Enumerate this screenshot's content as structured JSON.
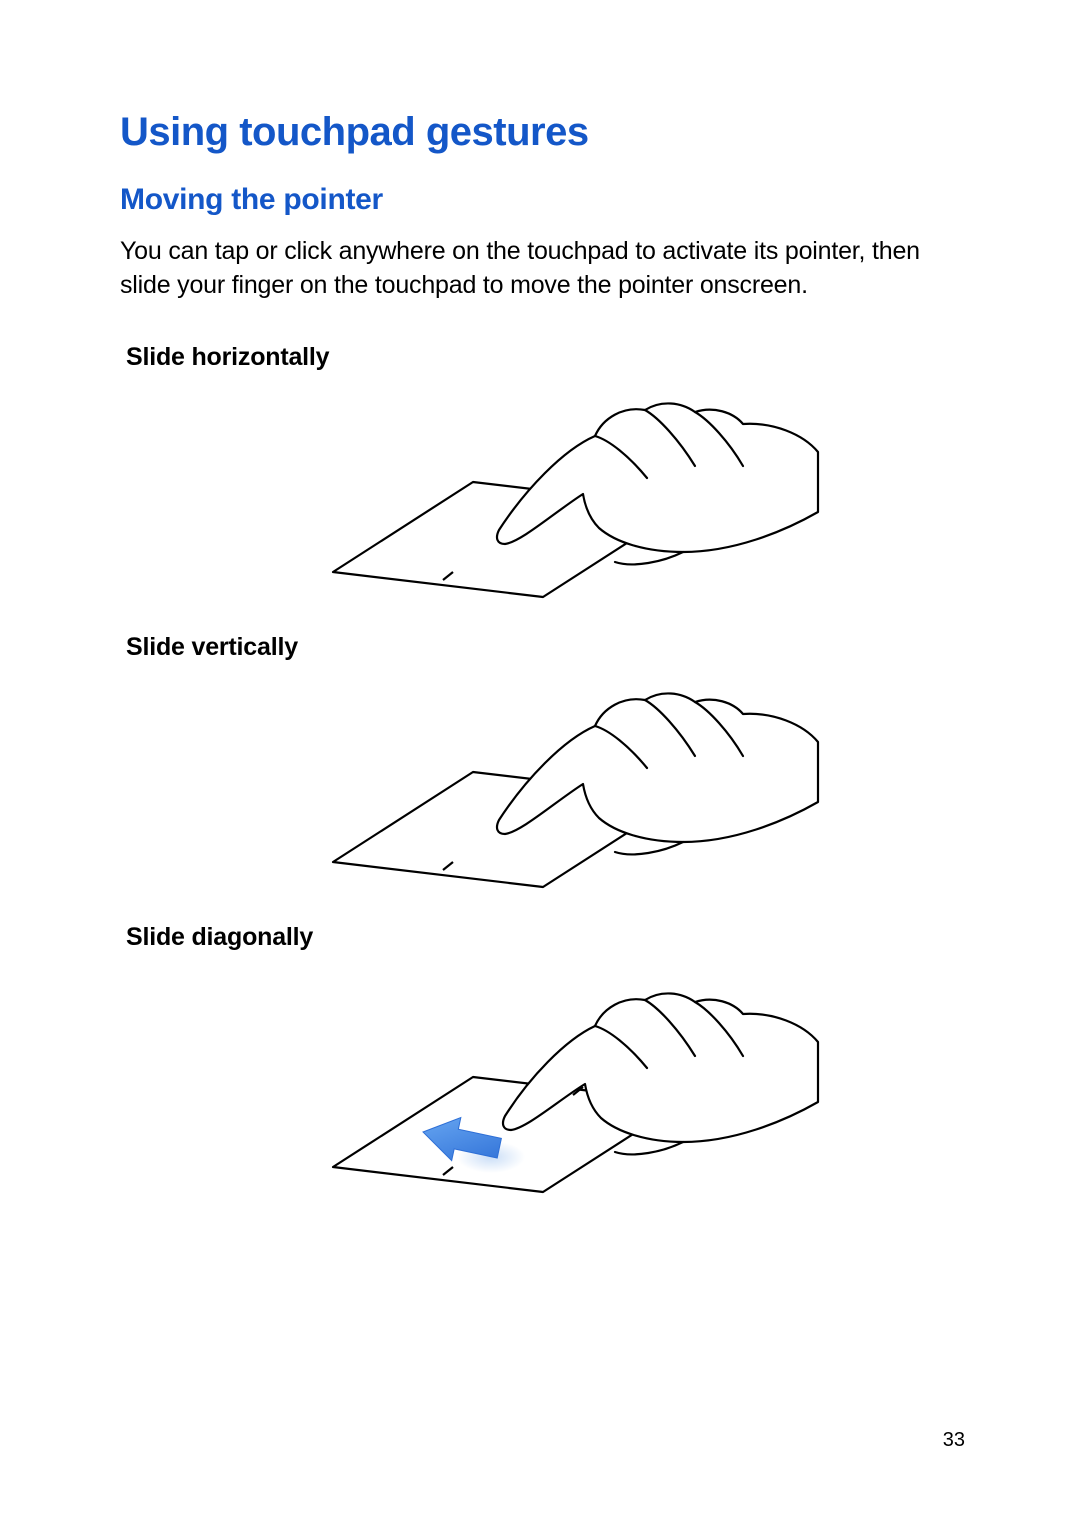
{
  "title": "Using touchpad gestures",
  "subtitle": "Moving the pointer",
  "body": "You can tap or click anywhere on the touchpad to activate its pointer, then slide your finger on the touchpad to move the pointer onscreen.",
  "gestures": {
    "horizontal": {
      "label": "Slide horizontally"
    },
    "vertical": {
      "label": "Slide vertically"
    },
    "diagonal": {
      "label": "Slide diagonally"
    }
  },
  "pageNumber": "33"
}
